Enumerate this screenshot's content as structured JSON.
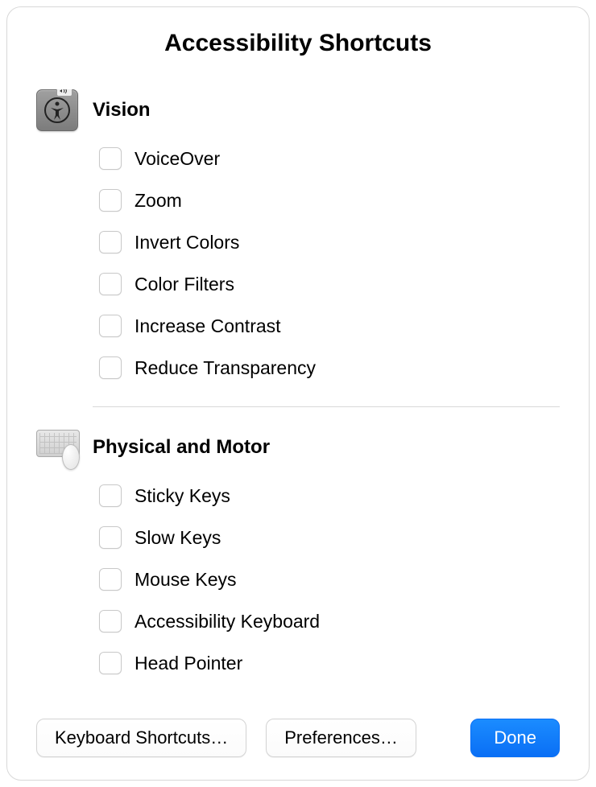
{
  "title": "Accessibility Shortcuts",
  "sections": [
    {
      "icon": "accessibility-vision-icon",
      "title": "Vision",
      "options": [
        {
          "label": "VoiceOver",
          "checked": false
        },
        {
          "label": "Zoom",
          "checked": false
        },
        {
          "label": "Invert Colors",
          "checked": false
        },
        {
          "label": "Color Filters",
          "checked": false
        },
        {
          "label": "Increase Contrast",
          "checked": false
        },
        {
          "label": "Reduce Transparency",
          "checked": false
        }
      ]
    },
    {
      "icon": "keyboard-mouse-icon",
      "title": "Physical and Motor",
      "options": [
        {
          "label": "Sticky Keys",
          "checked": false
        },
        {
          "label": "Slow Keys",
          "checked": false
        },
        {
          "label": "Mouse Keys",
          "checked": false
        },
        {
          "label": "Accessibility Keyboard",
          "checked": false
        },
        {
          "label": "Head Pointer",
          "checked": false
        }
      ]
    }
  ],
  "footer": {
    "keyboard_shortcuts": "Keyboard Shortcuts…",
    "preferences": "Preferences…",
    "done": "Done"
  }
}
